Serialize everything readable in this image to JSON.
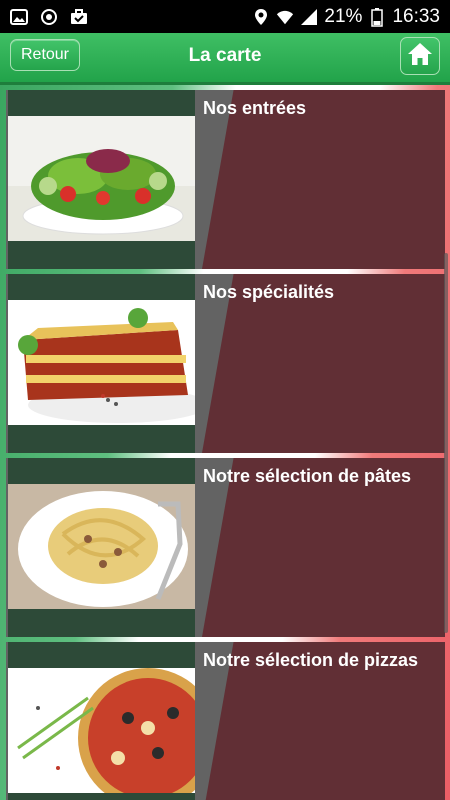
{
  "status_bar": {
    "battery": "21%",
    "time": "16:33",
    "icons": [
      "image-icon",
      "sync-icon",
      "briefcase-icon",
      "location-icon",
      "wifi-icon",
      "signal-icon",
      "battery-icon"
    ]
  },
  "header": {
    "back_label": "Retour",
    "title": "La carte",
    "home_icon": "home-icon"
  },
  "menu": {
    "items": [
      {
        "label": "Nos entrées",
        "image": "salad"
      },
      {
        "label": "Nos spécialités",
        "image": "lasagna"
      },
      {
        "label": "Notre sélection de pâtes",
        "image": "pasta"
      },
      {
        "label": "Notre sélection de pizzas",
        "image": "pizza"
      }
    ]
  },
  "colors": {
    "header_green": "#22a34a",
    "italian_green": "#3aa660",
    "italian_red": "#ec5e66",
    "item_grey": "#636363",
    "item_maroon": "#612f35",
    "thumb_dark": "#2d4a38"
  }
}
